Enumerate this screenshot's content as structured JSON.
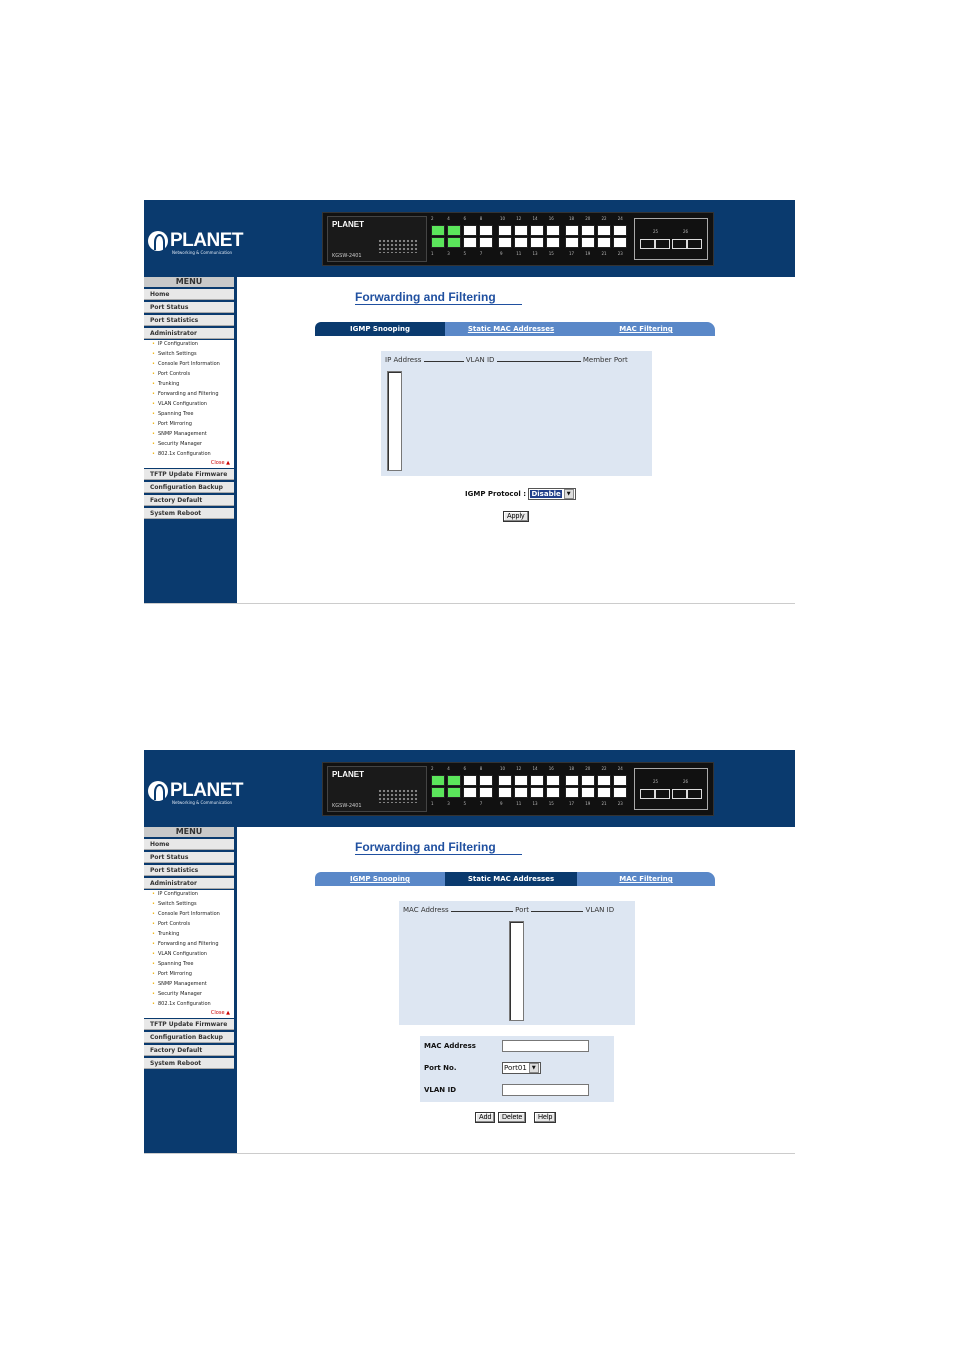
{
  "brand": {
    "logo_text": "PLANET",
    "tagline": "Networking & Communication"
  },
  "device": {
    "panel_logo": "PLANET",
    "model": "KGSW-2401",
    "port_numbers_top": [
      "2",
      "4",
      "6",
      "8",
      "10",
      "12",
      "14",
      "16",
      "18",
      "20",
      "22",
      "24"
    ],
    "port_numbers_bottom": [
      "1",
      "3",
      "5",
      "7",
      "9",
      "11",
      "13",
      "15",
      "17",
      "19",
      "21",
      "23"
    ],
    "sfp_labels": [
      "25",
      "26"
    ]
  },
  "menu": {
    "header": "MENU",
    "items_top": [
      "Home",
      "Port Status",
      "Port Statistics",
      "Administrator"
    ],
    "sub_items": [
      "IP Configuration",
      "Switch Settings",
      "Console Port Information",
      "Port Controls",
      "Trunking",
      "Forwarding and Filtering",
      "VLAN Configuration",
      "Spanning Tree",
      "Port Mirroring",
      "SNMP Management",
      "Security Manager",
      "802.1x Configuration"
    ],
    "close": "Close",
    "items_bottom": [
      "TFTP Update Firmware",
      "Configuration Backup",
      "Factory Default",
      "System Reboot"
    ]
  },
  "page_title": "Forwarding and Filtering",
  "tabs": [
    "IGMP Snooping",
    "Static MAC Addresses",
    "MAC Filtering"
  ],
  "screen1": {
    "active_tab": 0,
    "col1": "IP Address",
    "col2": "VLAN ID",
    "col3": "Member Port",
    "igmp_label": "IGMP Protocol :",
    "igmp_value": "Disable",
    "apply": "Apply"
  },
  "screen2": {
    "active_tab": 1,
    "col1": "MAC Address",
    "col2": "Port",
    "col3": "VLAN ID",
    "field_mac": "MAC Address",
    "field_port": "Port No.",
    "port_value": "Port01",
    "field_vlan": "VLAN ID",
    "add": "Add",
    "delete": "Delete",
    "help": "Help"
  }
}
